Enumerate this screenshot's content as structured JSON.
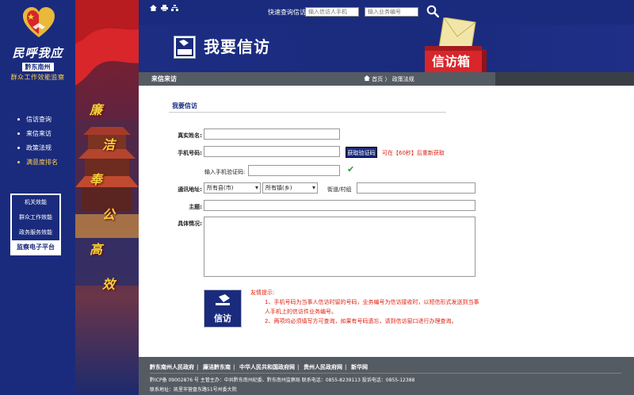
{
  "brand": {
    "logo_main": "民呼我应",
    "logo_sub": "黔东南州",
    "logo_tag": "群众工作效能监察"
  },
  "sidebar": {
    "items": [
      {
        "label": "信访查询"
      },
      {
        "label": "来信来访"
      },
      {
        "label": "政策法规"
      },
      {
        "label": "满意度排名"
      }
    ],
    "platform_links": [
      "机关效能",
      "群众工作效能",
      "政务服务效能"
    ],
    "platform_title": "监察电子平台"
  },
  "slogan": [
    "廉",
    "洁",
    "奉",
    "公",
    "高",
    "效"
  ],
  "header": {
    "quick_query_label": "快速查询信访",
    "phone_placeholder": "输入信访人手机",
    "code_placeholder": "输入业务编号",
    "banner_badge": "信访",
    "banner_title": "我要信访",
    "mailbox_label": "信访箱"
  },
  "subbar": {
    "title": "来信来访",
    "home": "首页",
    "separator": "〉",
    "current": "政策法规"
  },
  "form": {
    "title": "我要信访",
    "name_label": "真实姓名:",
    "phone_label": "手机号码:",
    "sms_button": "获取验证码",
    "resend_text": "可在【60秒】后重新获取",
    "code_label": "输入手机验证码:",
    "address_label": "通讯地址:",
    "county_select": "所有县(市)",
    "town_select": "所有镇(乡)",
    "street_label": "街道/村组",
    "subject_label": "主题:",
    "detail_label": "具体情况:"
  },
  "notice": {
    "icon_label": "信访",
    "title": "友情提示:",
    "line1": "1、手机号码为当事人信访时留的号码，业务编号为信访接收时，以短信形式发送到当事人手机上的信访件业务编号。",
    "line2": "2、两项均必须填写方可查询，如果有号码遗忘，请到信访窗口进行办理查询。"
  },
  "footer": {
    "links": [
      "黔东南州人民政府",
      "廉洁黔东南",
      "中华人民共和国政府网",
      "贵州人民政府网",
      "新华网"
    ],
    "line1": "黔ICP备 09002876 号  主管主办：中共黔东南州纪委、黔东南州监察局  联系电话：0855-8239113  投诉电话：0855-12388",
    "line2": "联系地址：凯里市营盘东路51号州委大院"
  },
  "colors": {
    "navy": "#1a2b7d",
    "red": "#d21",
    "gray_bar": "#555b63",
    "gold": "#ffd24a"
  }
}
